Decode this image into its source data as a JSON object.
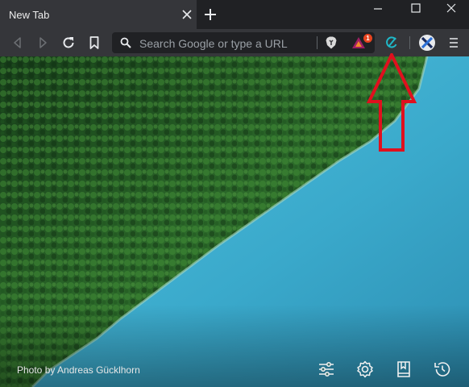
{
  "window": {
    "tab_title": "New Tab",
    "buttons": [
      "minimize",
      "maximize",
      "close"
    ]
  },
  "toolbar": {
    "search_placeholder": "Search Google or type a URL",
    "rewards_badge_count": "1",
    "icons": [
      "back-icon",
      "forward-icon",
      "reload-icon",
      "bookmark-icon",
      "search-icon",
      "brave-shield-icon",
      "brave-rewards-icon",
      "extension-icon",
      "profile-icon",
      "menu-icon"
    ]
  },
  "new_tab_page": {
    "photo_credit_prefix": "Photo by",
    "photo_credit_author": "Andreas Gücklhorn",
    "bottom_icons": [
      "customize-icon",
      "settings-icon",
      "bookmarks-icon",
      "history-icon"
    ]
  },
  "annotation": {
    "arrow_color": "#e0101e",
    "points_to": "extension-icon"
  },
  "colors": {
    "tab_bar": "#202124",
    "toolbar": "#35363a",
    "extension_accent": "#1fb8c8",
    "lake": "#3fb2d2",
    "forest": "#2e6a2a"
  }
}
